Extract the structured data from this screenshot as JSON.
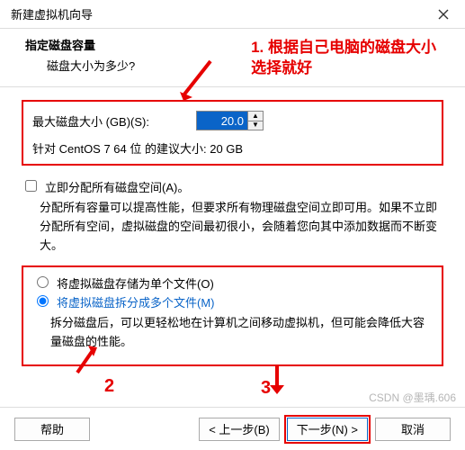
{
  "window": {
    "title": "新建虚拟机向导"
  },
  "header": {
    "heading": "指定磁盘容量",
    "sub": "磁盘大小为多少?"
  },
  "annotations": {
    "note1_line1": "1. 根据自己电脑的磁盘大小",
    "note1_line2": "选择就好",
    "num2": "2",
    "num3": "3"
  },
  "disk": {
    "size_label": "最大磁盘大小 (GB)(S):",
    "size_value": "20.0",
    "recommend": "针对 CentOS 7 64 位 的建议大小: 20 GB"
  },
  "allocate": {
    "label": "立即分配所有磁盘空间(A)。",
    "desc": "分配所有容量可以提高性能，但要求所有物理磁盘空间立即可用。如果不立即分配所有空间，虚拟磁盘的空间最初很小，会随着您向其中添加数据而不断变大。"
  },
  "store": {
    "single_label": "将虚拟磁盘存储为单个文件(O)",
    "split_label": "将虚拟磁盘拆分成多个文件(M)",
    "split_desc": "拆分磁盘后，可以更轻松地在计算机之间移动虚拟机，但可能会降低大容量磁盘的性能。"
  },
  "buttons": {
    "help": "帮助",
    "back": "< 上一步(B)",
    "next": "下一步(N) >",
    "cancel": "取消"
  },
  "watermark": "CSDN @墨瑀.606"
}
